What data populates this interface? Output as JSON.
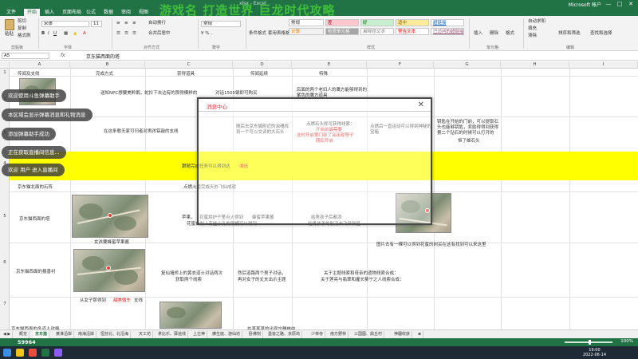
{
  "window": {
    "title": "xlsx - Excel",
    "user": "Microsoft 帐户",
    "controls": [
      "—",
      "□",
      "✕"
    ]
  },
  "overlay_title": "游戏名 打造世界 巨龙时代攻略",
  "tabs": [
    "文件",
    "开始",
    "插入",
    "页面布局",
    "公式",
    "数据",
    "审阅",
    "视图"
  ],
  "active_tab_index": 1,
  "ribbon": {
    "paste": "粘贴",
    "cut": "剪切",
    "copy": "复制",
    "format_painter": "格式刷",
    "clipboard_group": "剪贴板",
    "font_name": "宋体",
    "font_size": "11",
    "font_group": "字体",
    "align_group": "对齐方式",
    "wrap": "自动换行",
    "merge": "合并后居中",
    "number_format": "常规",
    "number_group": "数字",
    "cond_format": "条件格式",
    "table_format": "套用表格格式",
    "styles_group": "样式",
    "cells_group": "单元格",
    "insert": "插入",
    "delete": "删除",
    "format": "格式",
    "editing_group": "编辑",
    "autosum": "自动求和",
    "fill": "填充",
    "clear": "清除",
    "sort": "排序和筛选",
    "find": "查找和选择",
    "styles": [
      "常规",
      "差",
      "好",
      "适中",
      "超链接",
      "计算",
      "检查单元格",
      "解释性文本",
      "警告文本",
      "已访问的超链接"
    ]
  },
  "formula_bar": {
    "name_box": "A5",
    "fx": "fx",
    "content": "京东猫西面的塔"
  },
  "columns": [
    "A",
    "B",
    "C",
    "D",
    "E",
    "F",
    "G",
    "H",
    "I"
  ],
  "rows": [
    "1",
    "2",
    "3",
    "4",
    "5",
    "6",
    "7"
  ],
  "header_row": [
    "传闻及支线",
    "完成方式",
    "获得道具",
    "传闻延续",
    "特殊"
  ],
  "cells": {
    "r2_b": "送知NPC想要美黔鹅，蛇拎下去边有的那得模样的",
    "r2_b2": "对话1500钢即可购买",
    "r2_e": "后面的两个老妇人的鹰方能够得到的紫色的鹰方道具",
    "r3_b": "在这条歌无家可归者对男孩铝敲的支线",
    "r3_d": "随后去京东猫附近的浊魂找到一个可以交谈的大石头",
    "r3_e1": "点燃石头即可获得线索：",
    "r3_e2": "开启前最需要",
    "r3_e3": "这时开启第门前了会出现孽子",
    "r3_e4": "随后开启",
    "r3_f": "点燃后一直运动可以得到神秘的宝箱",
    "r3_g": "钥匙在开始的门前，可以提取石头也能够钥匙，奖励得得到获得第二个钻石的时候可以打开的",
    "r3_g2": "恒了维石头",
    "r4_mid": "跟随完成任务可以得到达",
    "r4_mid_red": "湘追",
    "r4_a": "京东猫北面的石阵",
    "r4_b": "点燃火炬完成天外飞仙成就",
    "r5_a": "京东猫西面的塔",
    "r5_c1": "苹果，",
    "r5_c1b": "花蜜烘护子里点火得到",
    "r5_c1c": "蜂蜜苹果酱",
    "r5_c2": "花蜜自制上有些小孔的钢桶可以得到",
    "r5_e1": "给男孩子后都添",
    "r5_e2": "给男孩子的射刀去飞升新星",
    "r5_b_cap": "女孩要蜂蜜苹果酱",
    "r5_f": "图片去有一棵可以得到花蜜的树买在这有找到可以来这里",
    "r6_a": "京东猫西面的报香衬",
    "r6_c1": "复仙墙桥上的黄衣道士对话两次",
    "r6_c2": "获取两个线索",
    "r6_d1": "然后道路两个男子对话，",
    "r6_d2": "再对女子的丈夫出示主题",
    "r6_e1": "关于主题线索和母亲的遗物线索合成：",
    "r6_e2": "关于莲亮与翡翠和握长葵宁之人线索合成：",
    "r6_b_cap": "从女子那得到",
    "r6_b_cap_red": "甜美微东",
    "r6_b_cap2": "支线",
    "r7_a": "京东猫西面的冬道人攻略",
    "r7_b": "在某某某的出现宁静林中"
  },
  "dialog": {
    "title": "消息中心",
    "close": "✕"
  },
  "toasts": [
    "欢迎使用斗鱼弹幕助手",
    "本区域会显示弹幕消息和礼物消息",
    "添加弹幕助手成功",
    "正在获取直播间信息...",
    "欢迎 用户 进入直播间"
  ],
  "sheet_tabs": [
    "概览",
    "京东猫",
    "黄淮沿岸",
    "南海沿岸",
    "恒芬北、北沿海",
    "天工坊",
    "拿比乐、驿途线",
    "上古神",
    "拂生底、游仙坊",
    "卧佛刻",
    "墨兽之路、京原坞",
    "少林寺",
    "南方野林",
    "三国图、鼎丘村",
    "神器收获"
  ],
  "active_sheet_index": 1,
  "status": {
    "count": "59964",
    "zoom": "100%",
    "zoom_fraction": 0.5
  },
  "taskbar": {
    "time": "19:00",
    "date": "2022-06-14"
  }
}
